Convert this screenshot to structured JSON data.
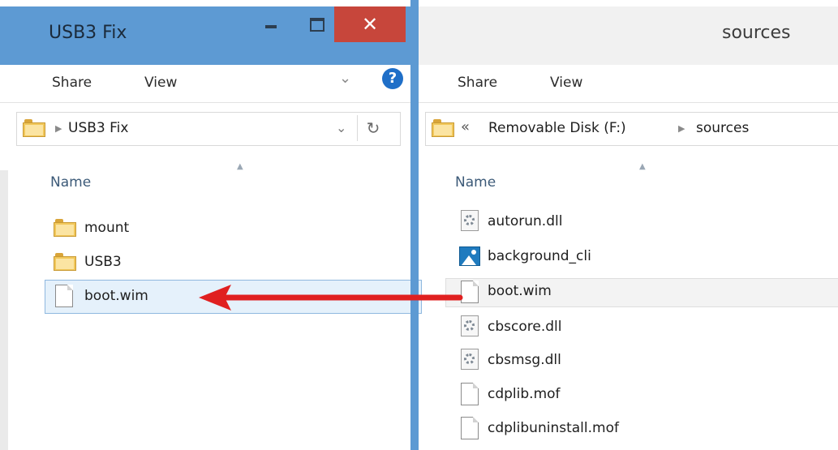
{
  "left_window": {
    "title": "USB3 Fix",
    "ribbon": {
      "share": "Share",
      "view": "View"
    },
    "address": {
      "path": "USB3 Fix"
    },
    "column_header": "Name",
    "items": [
      {
        "name": "mount",
        "icon": "folder-icon"
      },
      {
        "name": "USB3",
        "icon": "folder-icon"
      },
      {
        "name": "boot.wim",
        "icon": "file-icon",
        "selected": true
      }
    ],
    "caption": {
      "minimize": "minimize-icon",
      "maximize": "maximize-icon",
      "close": "close-icon"
    }
  },
  "right_window": {
    "title": "sources",
    "ribbon": {
      "share": "Share",
      "view": "View"
    },
    "address": {
      "overflow": "«",
      "drive": "Removable Disk (F:)",
      "folder": "sources"
    },
    "column_header": "Name",
    "items": [
      {
        "name": "autorun.dll",
        "icon": "dll-icon"
      },
      {
        "name": "background_cli",
        "icon": "image-icon"
      },
      {
        "name": "boot.wim",
        "icon": "file-icon",
        "hovered": true
      },
      {
        "name": "cbscore.dll",
        "icon": "dll-icon"
      },
      {
        "name": "cbsmsg.dll",
        "icon": "dll-icon"
      },
      {
        "name": "cdplib.mof",
        "icon": "file-icon"
      },
      {
        "name": "cdplibuninstall.mof",
        "icon": "file-icon"
      }
    ]
  },
  "annotation": {
    "icon": "red-arrow-icon",
    "color": "#e02020"
  },
  "colors": {
    "titlebar_active": "#5d9ad3",
    "close_button": "#c7463b",
    "selection": "#e5f1fb"
  }
}
